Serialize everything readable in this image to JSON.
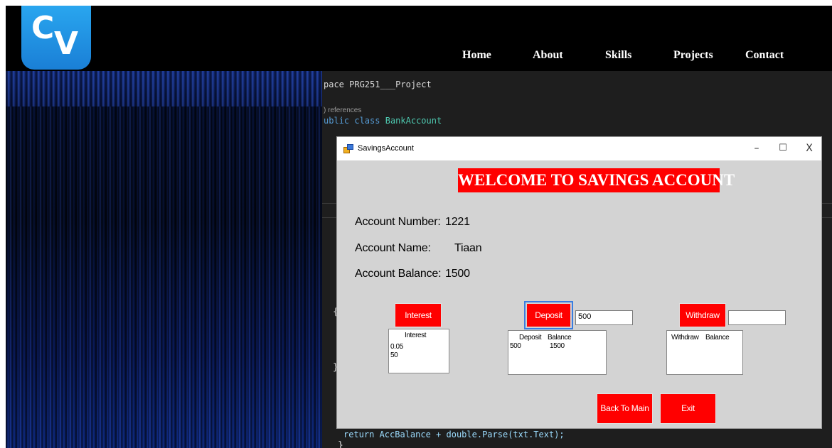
{
  "logo": {
    "letters_c": "C",
    "letters_v": "V"
  },
  "nav": {
    "items": [
      "Home",
      "About",
      "Skills",
      "Projects",
      "Contact"
    ]
  },
  "code": {
    "line1": "pace PRG251___Project",
    "refs": ") references",
    "line2_kw": "ublic class",
    "line2_cls": "BankAccount",
    "brace_open": "{",
    "brace_close": "}",
    "bottom_line": "return AccBalance + double.Parse(txt.Text);"
  },
  "window": {
    "title": "SavingsAccount",
    "minimize": "–",
    "maximize": "☐",
    "close": "X",
    "banner": "WELCOME TO SAVINGS ACCOUNT",
    "account_number_label": "Account Number:",
    "account_number": "1221",
    "account_name_label": "Account Name:",
    "account_name": "Tiaan",
    "account_balance_label": "Account Balance:",
    "account_balance": "1500",
    "interest_button": "Interest",
    "deposit_button": "Deposit",
    "deposit_input": "500",
    "withdraw_button": "Withdraw",
    "withdraw_input": "",
    "interest_list": {
      "header": "Interest",
      "rows": [
        "0.05",
        "50"
      ]
    },
    "deposit_list": {
      "header_deposit": "Deposit",
      "header_balance": "Balance",
      "row_deposit": "500",
      "row_balance": "1500"
    },
    "withdraw_list": {
      "header_withdraw": "Withdraw",
      "header_balance": "Balance"
    },
    "back_button": "Back To Main",
    "exit_button": "Exit"
  },
  "colors": {
    "accent_red": "#ff0000",
    "logo_blue": "#1a7fd6",
    "dialog_gray": "#d3d3d3"
  }
}
